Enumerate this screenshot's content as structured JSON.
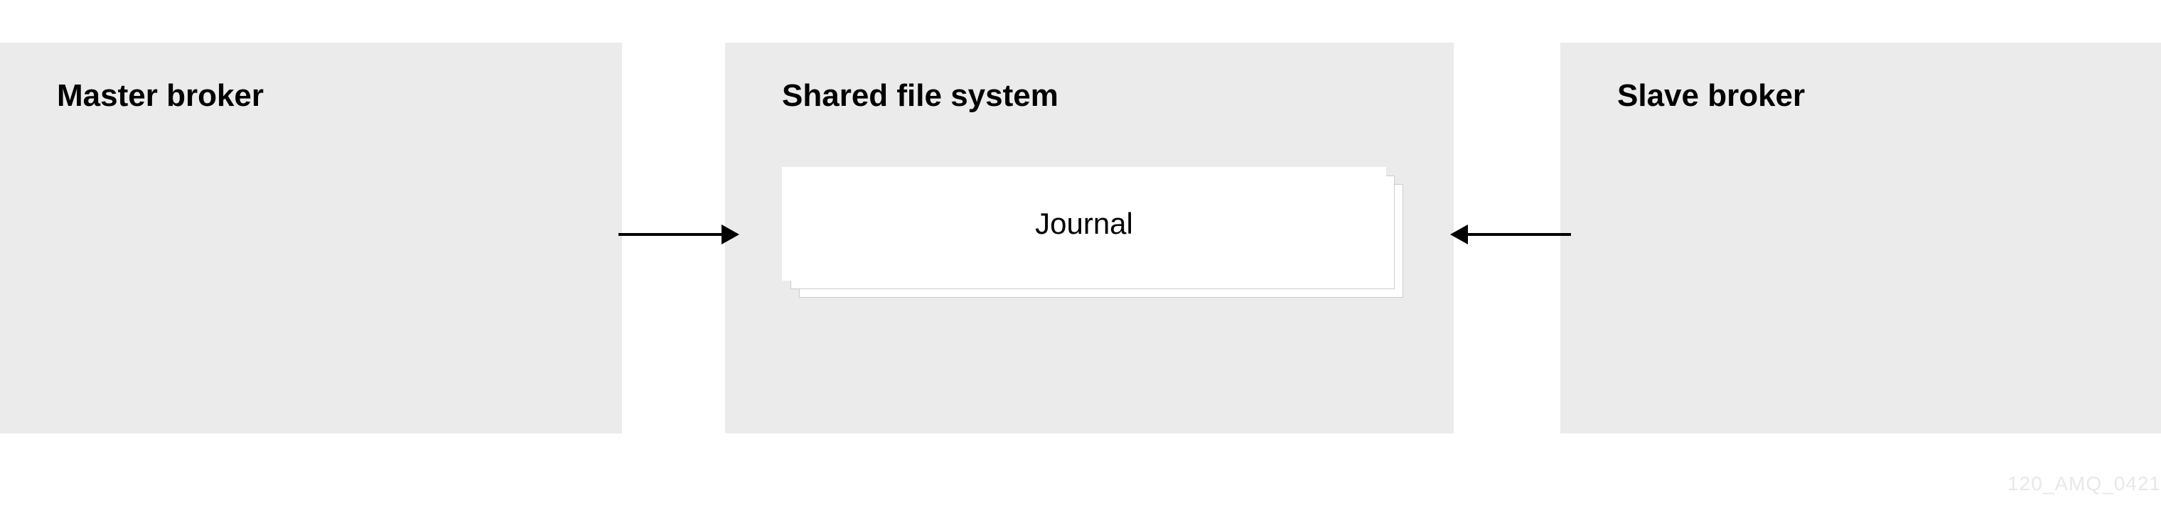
{
  "diagram": {
    "master": {
      "title": "Master broker"
    },
    "shared": {
      "title": "Shared file system",
      "journal": {
        "label": "Journal"
      }
    },
    "slave": {
      "title": "Slave broker"
    },
    "watermark": "120_AMQ_0421"
  }
}
